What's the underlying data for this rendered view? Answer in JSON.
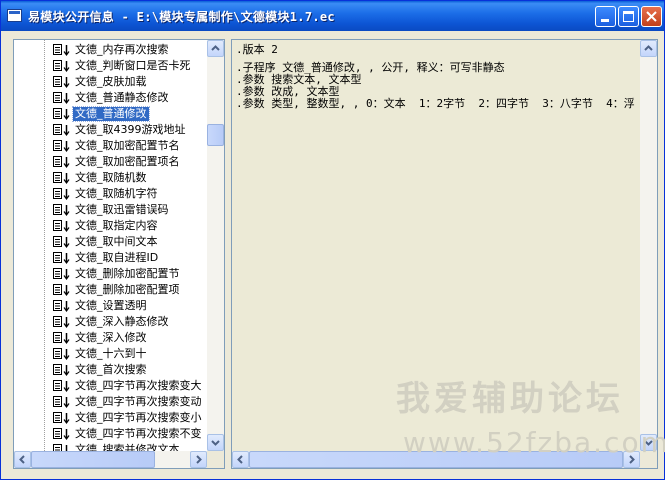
{
  "window": {
    "title": "易模块公开信息 - E:\\模块专属制作\\文德模块1.7.ec",
    "buttons": {
      "minimize": "minimize",
      "maximize": "maximize",
      "close": "close"
    }
  },
  "tree": {
    "selected_index": 4,
    "items": [
      "文德_内存再次搜索",
      "文德_判断窗口是否卡死",
      "文德_皮肤加载",
      "文德_普通静态修改",
      "文德_普通修改",
      "文德_取4399游戏地址",
      "文德_取加密配置节名",
      "文德_取加密配置项名",
      "文德_取随机数",
      "文德_取随机字符",
      "文德_取迅雷错误码",
      "文德_取指定内容",
      "文德_取中间文本",
      "文德_取自进程ID",
      "文德_删除加密配置节",
      "文德_删除加密配置项",
      "文德_设置透明",
      "文德_深入静态修改",
      "文德_深入修改",
      "文德_十六到十",
      "文德_首次搜索",
      "文德_四字节再次搜索变大",
      "文德_四字节再次搜索变动",
      "文德_四字节再次搜索变小",
      "文德_四字节再次搜索不变",
      "文德_搜索并修改文本"
    ]
  },
  "code": {
    "lines": [
      ".版本 2",
      "",
      ".子程序 文德_普通修改, , 公开, 释义：可写非静态",
      ".参数 搜索文本, 文本型",
      ".参数 改成, 文本型",
      ".参数 类型, 整数型, , 0：文本  1：2字节  2：四字节  3：八字节  4：浮"
    ]
  },
  "watermark": {
    "line1": "我爱辅助论坛",
    "line2": "www.52fzba.com"
  }
}
